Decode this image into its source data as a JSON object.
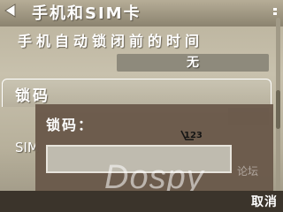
{
  "header": {
    "title": "手机和SIM卡"
  },
  "settings": {
    "autolock_label": "手机自动锁闭前的时间",
    "autolock_value": "无",
    "lock_code_label": "锁码",
    "sim_label_partial": "SIM"
  },
  "dialog": {
    "title": "锁码：",
    "input_mode": "123",
    "input_value": ""
  },
  "softkeys": {
    "right_label": "取消"
  },
  "watermark": {
    "text": "Dospy",
    "sub": "论坛"
  },
  "colors": {
    "dialog_bg": "#6b5a4b",
    "softkey_bg": "#3b342b",
    "value_box": "#8e8a7c"
  }
}
